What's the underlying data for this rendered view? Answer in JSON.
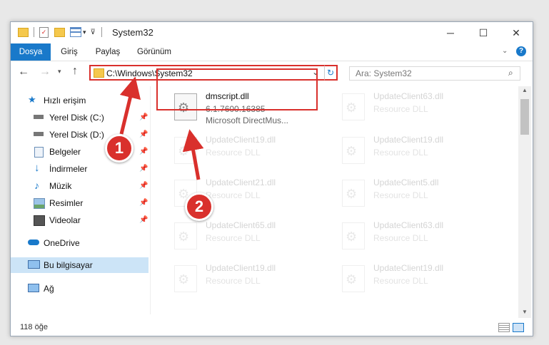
{
  "window": {
    "title": "System32"
  },
  "ribbon": {
    "tabs": [
      "Dosya",
      "Giriş",
      "Paylaş",
      "Görünüm"
    ]
  },
  "nav": {
    "address": "C:\\Windows\\System32",
    "search_placeholder": "Ara: System32"
  },
  "sidebar": {
    "items": [
      {
        "label": "Hızlı erişim",
        "icon": "star-icon"
      },
      {
        "label": "Yerel Disk (C:)",
        "icon": "drive-icon",
        "pinned": true
      },
      {
        "label": "Yerel Disk (D:)",
        "icon": "drive-icon",
        "pinned": true
      },
      {
        "label": "Belgeler",
        "icon": "documents-icon",
        "pinned": true
      },
      {
        "label": "İndirmeler",
        "icon": "download-icon",
        "pinned": true
      },
      {
        "label": "Müzik",
        "icon": "music-icon",
        "pinned": true
      },
      {
        "label": "Resimler",
        "icon": "pictures-icon",
        "pinned": true
      },
      {
        "label": "Videolar",
        "icon": "video-icon",
        "pinned": true
      },
      {
        "label": "OneDrive",
        "icon": "cloud-icon"
      },
      {
        "label": "Bu bilgisayar",
        "icon": "computer-icon",
        "selected": true
      },
      {
        "label": "Ağ",
        "icon": "network-icon"
      }
    ]
  },
  "files": [
    {
      "name": "dmscript.dll",
      "line2": "6.1.7600.16385",
      "line3": "Microsoft DirectMus...",
      "highlighted": true
    },
    {
      "name": "UpdateClient63.dll",
      "line2": "Resource DLL"
    },
    {
      "name": "UpdateClient19.dll",
      "line2": "Resource DLL"
    },
    {
      "name": "UpdateClient19.dll",
      "line2": "Resource DLL"
    },
    {
      "name": "UpdateClient21.dll",
      "line2": "Resource DLL"
    },
    {
      "name": "UpdateClient5.dll",
      "line2": "Resource DLL"
    },
    {
      "name": "UpdateClient65.dll",
      "line2": "Resource DLL"
    },
    {
      "name": "UpdateClient63.dll",
      "line2": "Resource DLL"
    },
    {
      "name": "UpdateClient19.dll",
      "line2": "Resource DLL"
    },
    {
      "name": "UpdateClient19.dll",
      "line2": "Resource DLL"
    }
  ],
  "status": {
    "item_count": "118 öğe"
  },
  "markers": [
    "1",
    "2"
  ],
  "colors": {
    "accent": "#1979ca",
    "highlight": "#d9302c",
    "selected": "#cce4f7"
  }
}
